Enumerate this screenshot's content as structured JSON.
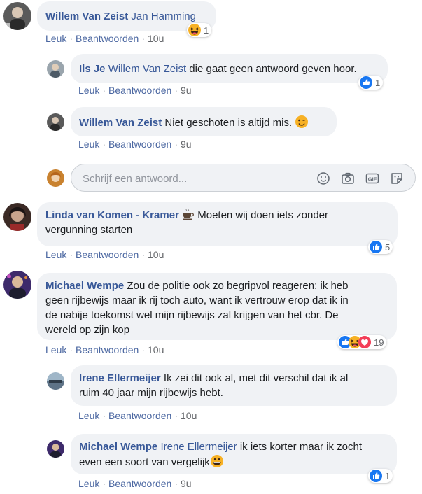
{
  "comments": [
    {
      "author": "Willem Van Zeist",
      "mention": "Jan Hamming",
      "text": "",
      "actions": {
        "like": "Leuk",
        "reply": "Beantwoorden",
        "time": "10u"
      },
      "reaction_count": "1"
    },
    {
      "author": "Ils Je",
      "mention": "Willem Van Zeist",
      "text": " die gaat geen antwoord geven hoor.",
      "actions": {
        "like": "Leuk",
        "reply": "Beantwoorden",
        "time": "9u"
      },
      "reaction_count": "1"
    },
    {
      "author": "Willem Van Zeist",
      "mention": "",
      "text": " Niet geschoten is altijd mis. ",
      "actions": {
        "like": "Leuk",
        "reply": "Beantwoorden",
        "time": "9u"
      }
    },
    {
      "author": "Linda van Komen - Kramer",
      "line1": " Moeten wij doen iets zonder",
      "line2": "vergunning starten",
      "actions": {
        "like": "Leuk",
        "reply": "Beantwoorden",
        "time": "10u"
      },
      "reaction_count": "5"
    },
    {
      "author": "Michael Wempe",
      "line1": " Zou de politie ook zo begripvol reageren: ik heb",
      "line2": "geen rijbewijs maar ik rij toch auto, want ik vertrouw erop dat ik in",
      "line3": "de nabije toekomst wel mijn rijbewijs zal krijgen van het cbr. De",
      "line4": "wereld op zijn kop",
      "actions": {
        "like": "Leuk",
        "reply": "Beantwoorden",
        "time": "10u"
      },
      "reaction_count": "19"
    },
    {
      "author": "Irene Ellermeijer",
      "line1": " Ik zei dit ook al, met dit verschil dat ik al",
      "line2": "ruim 40 jaar mijn rijbewijs hebt.",
      "actions": {
        "like": "Leuk",
        "reply": "Beantwoorden",
        "time": "10u"
      }
    },
    {
      "author": "Michael Wempe",
      "mention": "Irene Ellermeijer",
      "line1": " ik iets korter maar ik zocht",
      "line2": "even een soort van vergelijk",
      "actions": {
        "like": "Leuk",
        "reply": "Beantwoorden",
        "time": "9u"
      },
      "reaction_count": "1"
    }
  ],
  "reply_box": {
    "placeholder": "Schrijf een antwoord..."
  },
  "colors": {
    "link": "#385898",
    "like_blue": "#1877f2",
    "love_red": "#f33e58",
    "haha_yellow": "#f7b125",
    "bubble": "#f0f2f5"
  },
  "icons": [
    "emoji-icon",
    "camera-icon",
    "gif-icon",
    "sticker-icon",
    "coffee-icon",
    "wink-emoji-icon",
    "grin-emoji-icon",
    "like-reaction-icon",
    "haha-reaction-icon",
    "love-reaction-icon"
  ]
}
